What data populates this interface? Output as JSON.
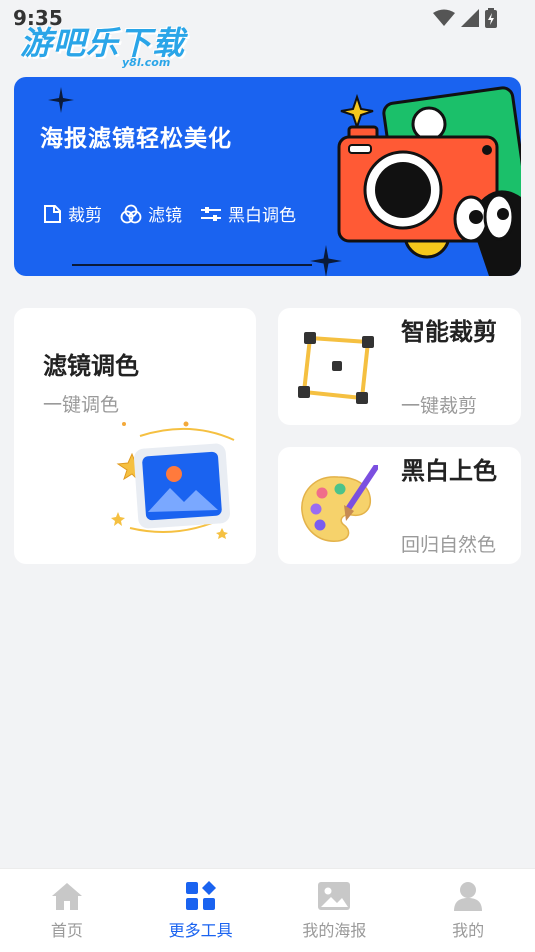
{
  "status_bar": {
    "time": "9:35"
  },
  "watermark": {
    "main": "游吧乐下载",
    "sub": "y8l.com"
  },
  "banner": {
    "title": "海报滤镜轻松美化",
    "features": [
      {
        "label": "裁剪",
        "icon": "crop-outline-icon"
      },
      {
        "label": "滤镜",
        "icon": "filter-circles-icon"
      },
      {
        "label": "黑白调色",
        "icon": "sliders-icon"
      }
    ],
    "colors": {
      "background": "#1a63f0"
    }
  },
  "cards": {
    "filter": {
      "title": "滤镜调色",
      "subtitle": "一键调色"
    },
    "crop": {
      "title": "智能裁剪",
      "subtitle": "一键裁剪"
    },
    "bw": {
      "title": "黑白上色",
      "subtitle": "回归自然色"
    }
  },
  "tabbar": {
    "active_index": 1,
    "items": [
      {
        "label": "首页",
        "icon": "home-icon"
      },
      {
        "label": "更多工具",
        "icon": "grid-tools-icon"
      },
      {
        "label": "我的海报",
        "icon": "image-icon"
      },
      {
        "label": "我的",
        "icon": "user-icon"
      }
    ],
    "colors": {
      "active": "#1a63f0",
      "inactive": "#9a9a9a"
    }
  }
}
